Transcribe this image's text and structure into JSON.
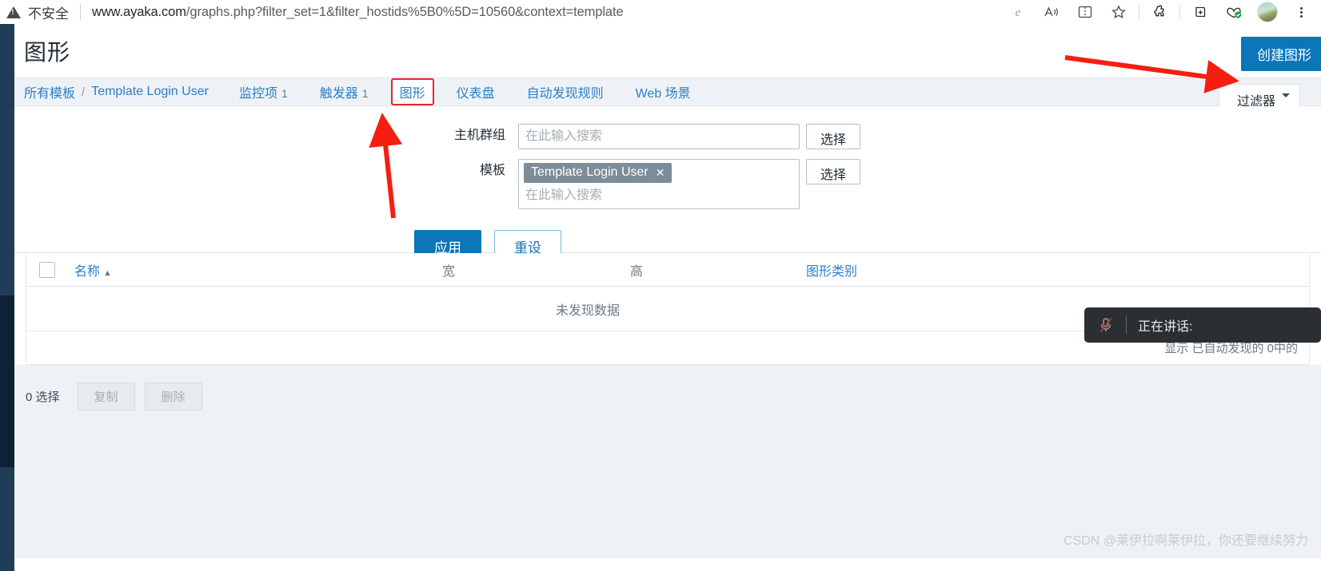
{
  "browser": {
    "security_label": "不安全",
    "url_host": "www.ayaka.com",
    "url_path": "/graphs.php?filter_set=1&filter_hostids%5B0%5D=10560&context=template",
    "icons": [
      "ie-mode-icon",
      "read-aloud-icon",
      "split-screen-icon",
      "favorite-star-icon",
      "extensions-puzzle-icon",
      "collections-icon",
      "browser-essentials-icon",
      "profile-avatar",
      "settings-menu-icon"
    ]
  },
  "header": {
    "title": "图形",
    "create_button": "创建图形"
  },
  "nav": {
    "breadcrumb_root": "所有模板",
    "breadcrumb_separator": "/",
    "breadcrumb_current": "Template Login User",
    "tabs": [
      {
        "label": "监控项",
        "count": "1",
        "active": false
      },
      {
        "label": "触发器",
        "count": "1",
        "active": false
      },
      {
        "label": "图形",
        "count": "",
        "active": true
      },
      {
        "label": "仪表盘",
        "count": "",
        "active": false
      },
      {
        "label": "自动发现规则",
        "count": "",
        "active": false
      },
      {
        "label": "Web 场景",
        "count": "",
        "active": false
      }
    ],
    "filter_tab": "过滤器"
  },
  "filter": {
    "host_group": {
      "label": "主机群组",
      "placeholder": "在此输入搜索",
      "value": "",
      "select_button": "选择"
    },
    "template": {
      "label": "模板",
      "placeholder": "在此输入搜索",
      "chip": "Template Login User",
      "chip_remove": "✕",
      "select_button": "选择"
    },
    "apply_button": "应用",
    "reset_button": "重设"
  },
  "table": {
    "columns": {
      "name": "名称",
      "sort_arrow": "▲",
      "width": "宽",
      "height": "高",
      "graph_type": "图形类别"
    },
    "empty_message": "未发现数据",
    "footer_text": "显示 已自动发现的 0中的"
  },
  "bottom": {
    "selected_count": "0 选择",
    "copy_button": "复制",
    "delete_button": "删除"
  },
  "toast": {
    "text": "正在讲话:",
    "icon": "microphone-muted-icon"
  },
  "watermark": "CSDN @莱伊拉啊莱伊拉，你还要继续努力",
  "colors": {
    "accent": "#0b76b8",
    "link": "#2a7fc9",
    "annotation": "#f41f10",
    "rail": "#1f3d57",
    "chip": "#7c8c99"
  }
}
